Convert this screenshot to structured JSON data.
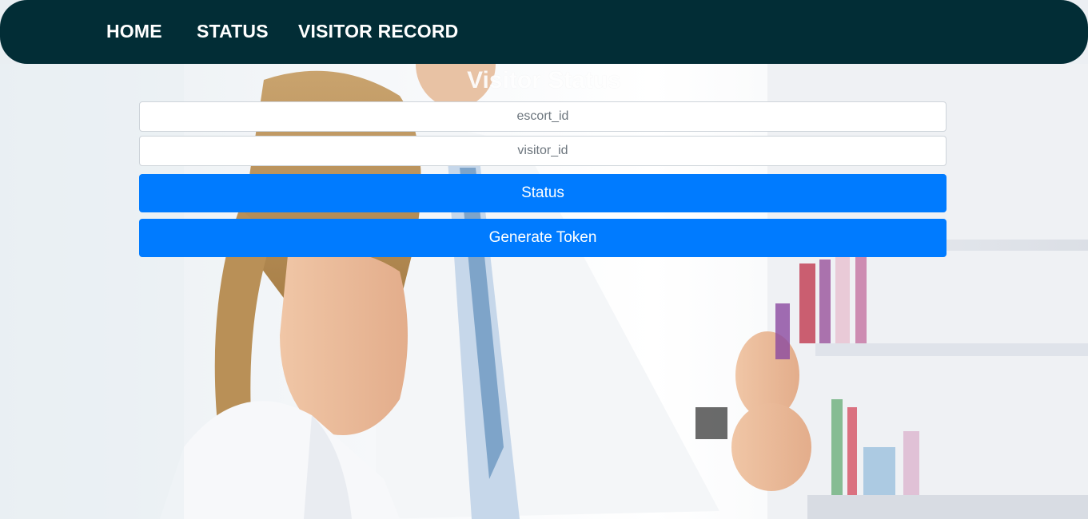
{
  "nav": {
    "items": [
      "HOME",
      "STATUS",
      "VISITOR RECORD"
    ]
  },
  "form": {
    "title": "Visitor Status",
    "escort_placeholder": "escort_id",
    "visitor_placeholder": "visitor_id",
    "status_button": "Status",
    "token_button": "Generate Token"
  },
  "colors": {
    "navbar": "#022d36",
    "button": "#007bff"
  },
  "background": {
    "description_icon": "pharmacist-photo"
  }
}
